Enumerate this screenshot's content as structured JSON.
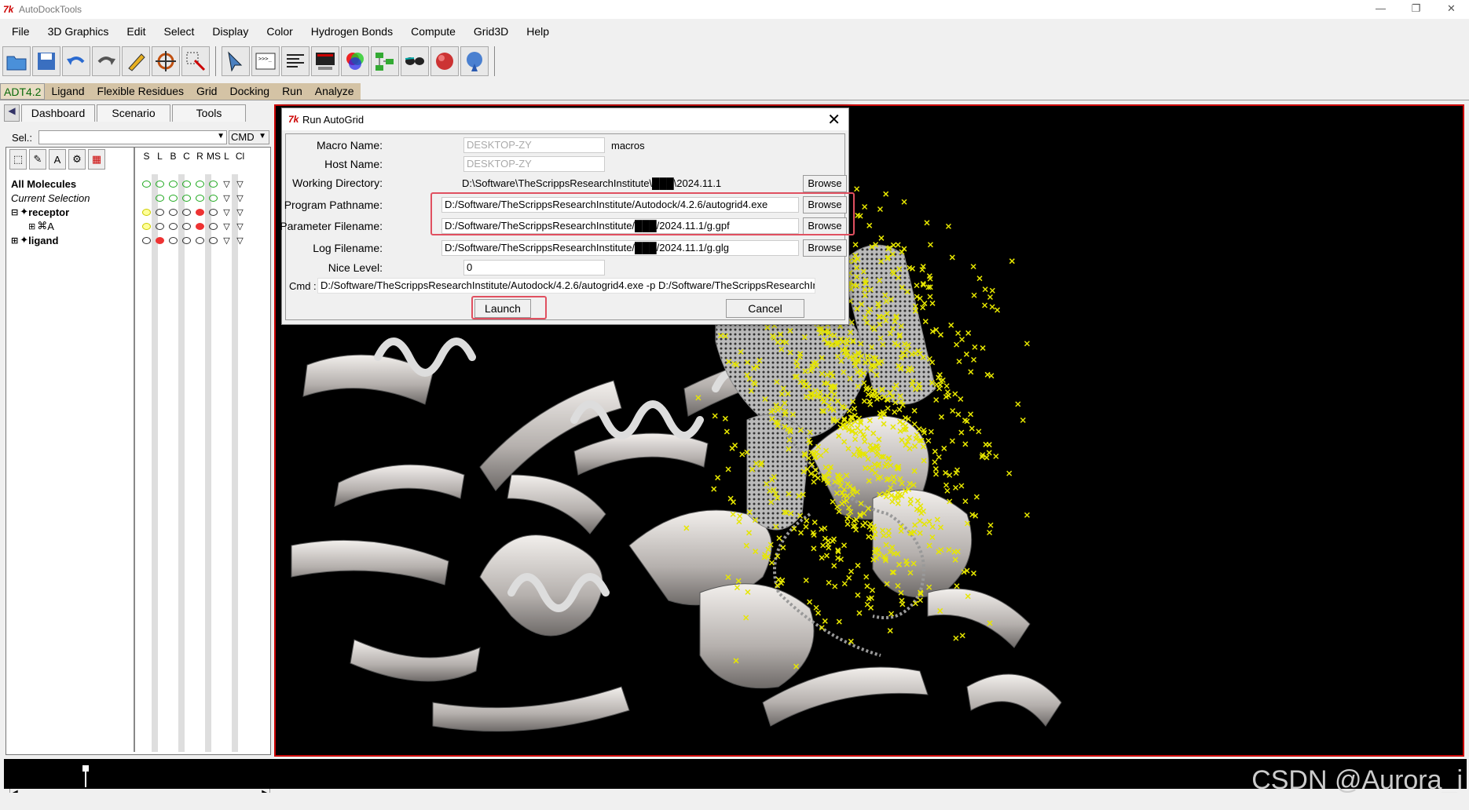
{
  "window": {
    "title": "AutoDockTools",
    "controls": [
      "—",
      "❐",
      "✕"
    ]
  },
  "menubar": [
    "File",
    "3D Graphics",
    "Edit",
    "Select",
    "Display",
    "Color",
    "Hydrogen Bonds",
    "Compute",
    "Grid3D",
    "Help"
  ],
  "adt_menu": [
    "ADT4.2",
    "Ligand",
    "Flexible Residues",
    "Grid",
    "Docking",
    "Run",
    "Analyze"
  ],
  "tabs": [
    "Dashboard",
    "Scenario",
    "Tools"
  ],
  "sel": {
    "label": "Sel.:",
    "value": "",
    "cmd": "CMD"
  },
  "dashboard_columns": [
    "S",
    "L",
    "B",
    "C",
    "R",
    "MS",
    "L",
    "Cl"
  ],
  "tree": {
    "all_molecules": "All Molecules",
    "current_selection": "Current Selection",
    "receptor": "receptor",
    "chain_a": "A",
    "ligand": "ligand"
  },
  "dialog": {
    "title": "Run AutoGrid",
    "macro_name": {
      "label": "Macro Name:",
      "value": "DESKTOP-ZY",
      "suffix": "macros"
    },
    "host_name": {
      "label": "Host Name:",
      "value": "DESKTOP-ZY"
    },
    "working_directory": {
      "label": "Working Directory:",
      "value": "D:\\Software\\TheScrippsResearchInstitute\\███\\2024.11.1"
    },
    "program_pathname": {
      "label": "Program Pathname:",
      "value": "D:/Software/TheScrippsResearchInstitute/Autodock/4.2.6/autogrid4.exe"
    },
    "parameter_filename": {
      "label": "Parameter Filename:",
      "value": "D:/Software/TheScrippsResearchInstitute/███/2024.11.1/g.gpf"
    },
    "log_filename": {
      "label": "Log Filename:",
      "value": "D:/Software/TheScrippsResearchInstitute/███/2024.11.1/g.glg"
    },
    "nice_level": {
      "label": "Nice Level:",
      "value": "0"
    },
    "cmd": {
      "label": "Cmd :",
      "value": "D:/Software/TheScrippsResearchInstitute/Autodock/4.2.6/autogrid4.exe -p D:/Software/TheScrippsResearchIn"
    },
    "browse_label": "Browse",
    "launch_label": "Launch",
    "cancel_label": "Cancel"
  },
  "watermark": "CSDN @Aurora_i",
  "colors": {
    "highlight": "#e05060",
    "viewer_border": "#cc0000",
    "grid_points": "#e6e600"
  }
}
